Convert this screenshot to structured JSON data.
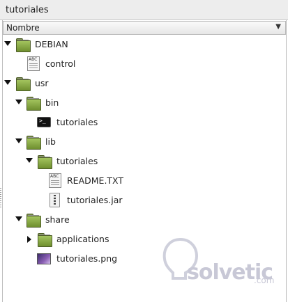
{
  "window": {
    "title": "tutoriales"
  },
  "column_header": {
    "label": "Nombre",
    "sort_arrow": "▼"
  },
  "tree": [
    {
      "label": "DEBIAN",
      "icon": "folder-icon",
      "expander": "expanded"
    },
    {
      "label": "control",
      "icon": "text-file-icon",
      "expander": "none"
    },
    {
      "label": "usr",
      "icon": "folder-icon",
      "expander": "expanded"
    },
    {
      "label": "bin",
      "icon": "folder-icon",
      "expander": "expanded"
    },
    {
      "label": "tutoriales",
      "icon": "terminal-icon",
      "expander": "none"
    },
    {
      "label": "lib",
      "icon": "folder-icon",
      "expander": "expanded"
    },
    {
      "label": "tutoriales",
      "icon": "folder-icon",
      "expander": "expanded"
    },
    {
      "label": "README.TXT",
      "icon": "text-file-icon",
      "expander": "none"
    },
    {
      "label": "tutoriales.jar",
      "icon": "jar-file-icon",
      "expander": "none"
    },
    {
      "label": "share",
      "icon": "folder-icon",
      "expander": "expanded"
    },
    {
      "label": "applications",
      "icon": "folder-icon",
      "expander": "collapsed"
    },
    {
      "label": "tutoriales.png",
      "icon": "image-file-icon",
      "expander": "none"
    }
  ],
  "watermark": {
    "brand": "solvetic",
    "domain": ".com"
  }
}
